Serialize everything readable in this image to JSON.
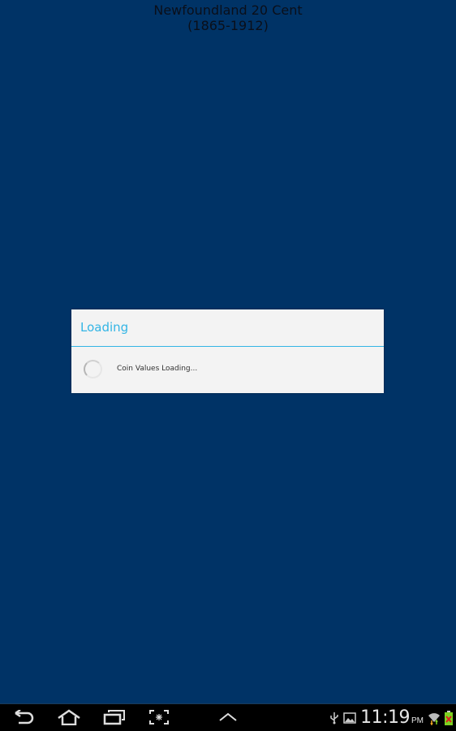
{
  "page": {
    "title_line1": "Newfoundland 20 Cent",
    "title_line2": "(1865-1912)"
  },
  "dialog": {
    "title": "Loading",
    "message": "Coin Values Loading...",
    "accent_color": "#33b5e5"
  },
  "navbar": {
    "buttons": [
      "back-icon",
      "home-icon",
      "recent-apps-icon",
      "screenshot-icon",
      "chevron-up-icon"
    ]
  },
  "status": {
    "time": "11:19",
    "ampm": "PM",
    "icons": [
      "usb-icon",
      "image-icon",
      "wifi-icon",
      "battery-icon"
    ]
  },
  "colors": {
    "background": "#003366",
    "dialog_bg": "#f3f3f3"
  }
}
